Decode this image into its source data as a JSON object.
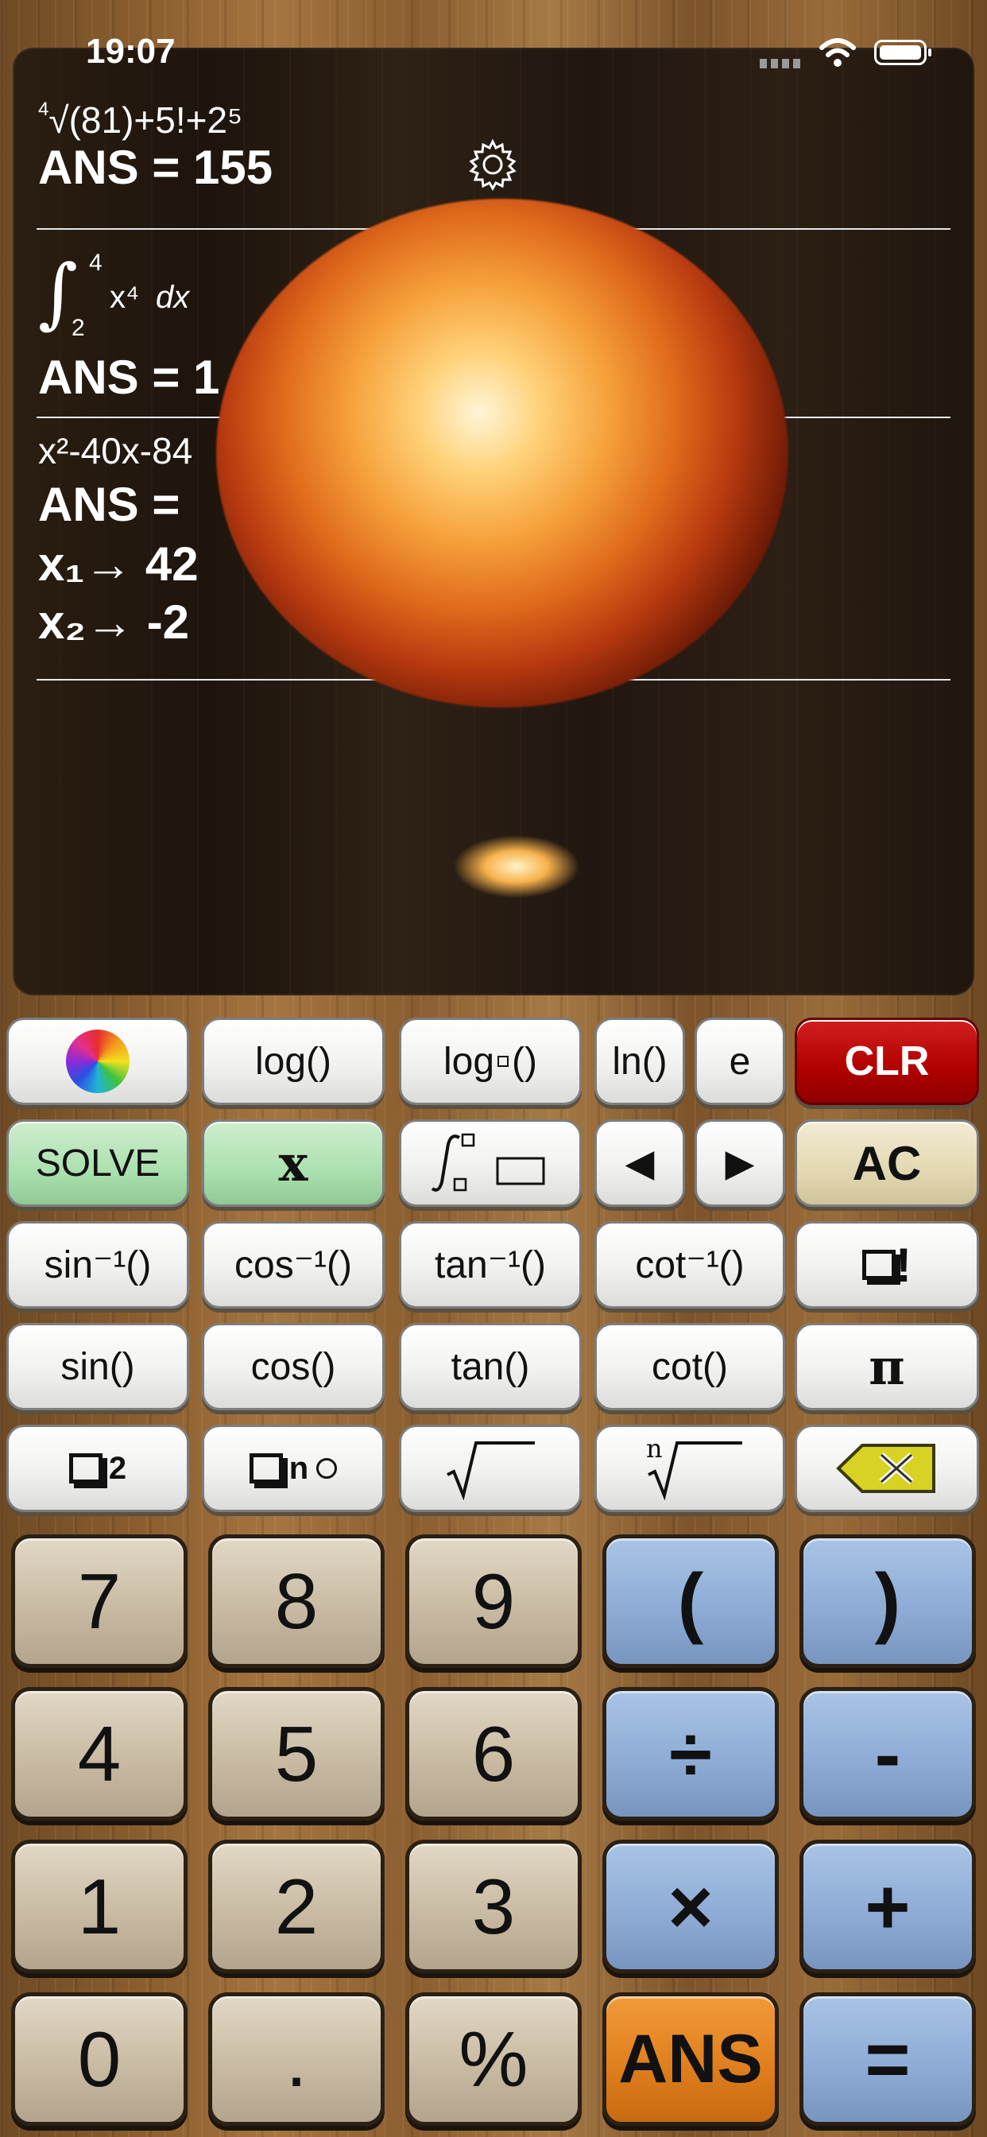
{
  "status": {
    "time": "19:07"
  },
  "history": [
    {
      "expression": "(81)+5!+2⁵",
      "root_index": "4",
      "answer": "ANS = 155"
    },
    {
      "upper": "4",
      "lower": "2",
      "integrand": "x⁴",
      "dx": "dx",
      "answer": "ANS = 1"
    },
    {
      "expression": "x²-40x-84",
      "answer": "ANS =",
      "roots": [
        {
          "label": "x₁→",
          "value": "42"
        },
        {
          "label": "x₂→",
          "value": "-2"
        }
      ]
    }
  ],
  "keys": {
    "row1": [
      "log()",
      "log",
      "()",
      "ln()",
      "e",
      "CLR"
    ],
    "row2": [
      "SOLVE",
      "x",
      "◀",
      "▶",
      "AC"
    ],
    "row3": [
      "sin⁻¹()",
      "cos⁻¹()",
      "tan⁻¹()",
      "cot⁻¹()",
      "!"
    ],
    "row4": [
      "sin()",
      "cos()",
      "tan()",
      "cot()",
      "π"
    ],
    "row5": [
      "2",
      "n",
      "n"
    ],
    "num": [
      "7",
      "8",
      "9",
      "(",
      ")",
      "4",
      "5",
      "6",
      "÷",
      "-",
      "1",
      "2",
      "3",
      "×",
      "+",
      "0",
      ".",
      "%",
      "ANS",
      "="
    ]
  },
  "icons": [
    "settings-gear-icon",
    "color-wheel-icon",
    "wifi-icon",
    "battery-icon",
    "integral-icon",
    "sqrt-icon",
    "nth-root-icon",
    "backspace-icon"
  ],
  "colors": {
    "clr": "#b00000",
    "solve": "#abe0af",
    "ac": "#e3d8b2",
    "operator": "#8eacd6",
    "ans": "#e07f1e"
  }
}
